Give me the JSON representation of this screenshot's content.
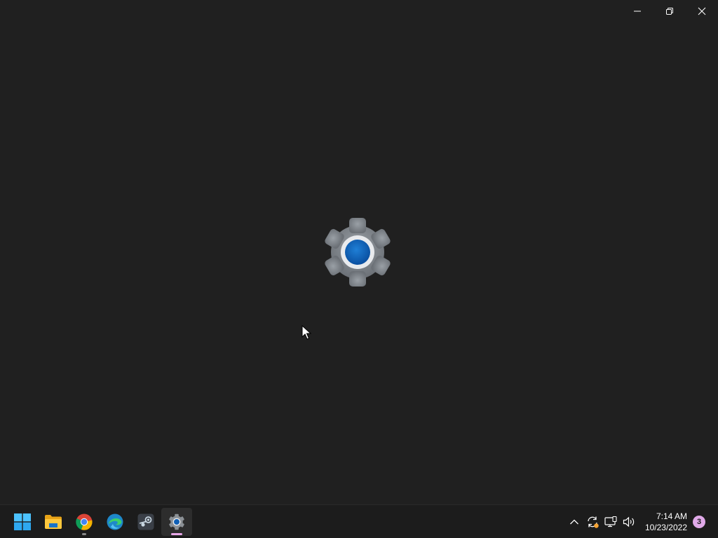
{
  "window": {
    "caption_buttons": [
      {
        "name": "minimize",
        "icon": "minimize-icon"
      },
      {
        "name": "restore",
        "icon": "restore-icon"
      },
      {
        "name": "close",
        "icon": "close-icon"
      }
    ],
    "splash_icon": "settings-gear-icon"
  },
  "taskbar": {
    "apps": [
      {
        "name": "start",
        "icon": "windows-logo-icon",
        "running": false,
        "active": false
      },
      {
        "name": "file-explorer",
        "icon": "folder-icon",
        "running": false,
        "active": false
      },
      {
        "name": "chrome",
        "icon": "chrome-icon",
        "running": true,
        "active": false
      },
      {
        "name": "edge",
        "icon": "edge-icon",
        "running": false,
        "active": false
      },
      {
        "name": "steam",
        "icon": "steam-icon",
        "running": false,
        "active": false
      },
      {
        "name": "settings",
        "icon": "settings-gear-icon",
        "running": true,
        "active": true
      }
    ],
    "tray": {
      "icons": [
        "chevron-up-icon",
        "sync-icon",
        "network-icon",
        "volume-icon"
      ],
      "time": "7:14 AM",
      "date": "10/23/2022",
      "notification_count": "3"
    }
  },
  "colors": {
    "background": "#202020",
    "taskbar": "#1c1c1c",
    "accent": "#0067c0",
    "active_indicator": "#e8a7e8"
  }
}
